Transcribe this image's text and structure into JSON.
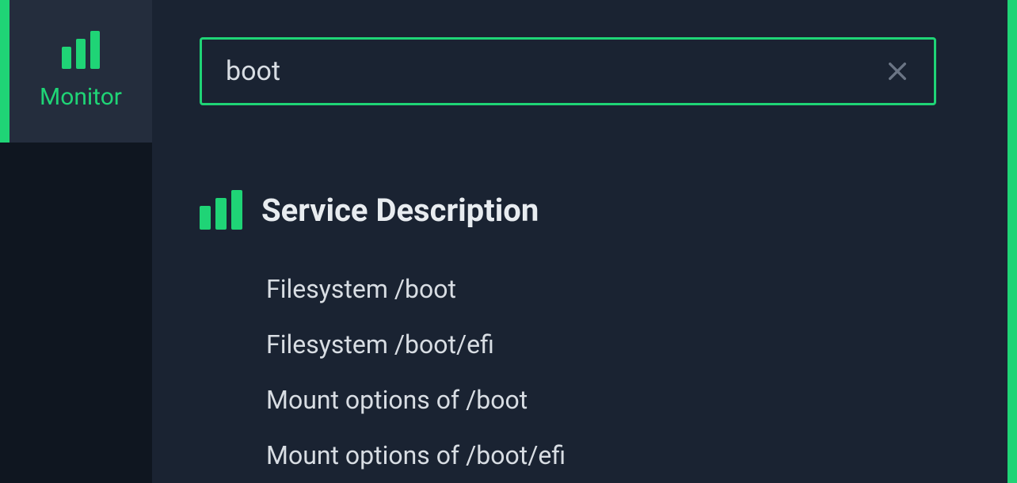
{
  "monitor": {
    "label": "Monitor"
  },
  "search": {
    "value": "boot",
    "placeholder": ""
  },
  "section": {
    "title": "Service Description"
  },
  "results": [
    "Filesystem /boot",
    "Filesystem /boot/efi",
    "Mount options of /boot",
    "Mount options of /boot/efi"
  ]
}
